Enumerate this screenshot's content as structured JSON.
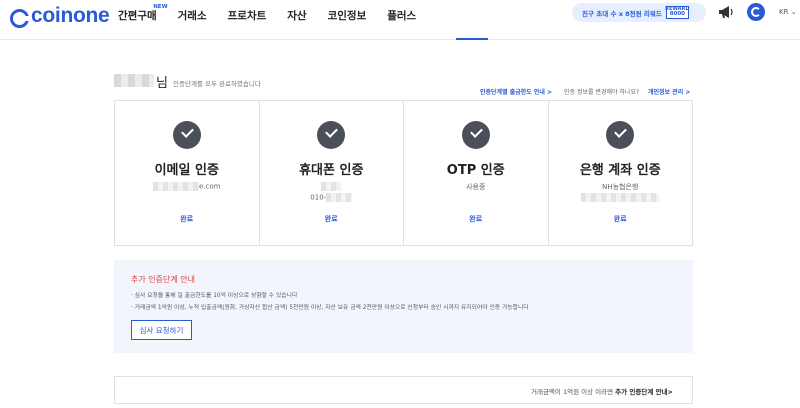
{
  "header": {
    "logo_text": "coinone",
    "nav": [
      {
        "label": "간편구매",
        "badge": "NEW"
      },
      {
        "label": "거래소"
      },
      {
        "label": "프로차트"
      },
      {
        "label": "자산"
      },
      {
        "label": "코인정보"
      },
      {
        "label": "플러스"
      }
    ],
    "promo_text": "친구 초대 수 x 8천원 리워드",
    "promo_badge_top": "REWARD",
    "promo_badge_bottom": "8000",
    "language": "KR"
  },
  "title_row": {
    "name_suffix": "님",
    "description": "인증단계를 모두 완료하였습니다",
    "limit_link": "인증단계별 출금한도 안내",
    "change_question": "인증 정보를 변경해야 하나요?",
    "manage_link": "개인정보 관리"
  },
  "cards": [
    {
      "title": "이메일 인증",
      "sub": "e.com",
      "sub2": "",
      "status": "완료"
    },
    {
      "title": "휴대폰 인증",
      "sub": "",
      "sub2": "010-",
      "status": "완료"
    },
    {
      "title": "OTP 인증",
      "sub": "사용중",
      "sub2": "",
      "status": "완료"
    },
    {
      "title": "은행 계좌 인증",
      "sub": "NH농협은행",
      "sub2": "",
      "status": "완료"
    }
  ],
  "notice": {
    "title": "추가 인증단계 안내",
    "line1": "· 심사 요청을 통해 일 출금한도를 10억 이상으로 상향할 수 있습니다",
    "line2": "· 거래금액 1억원 이상, 누적 입출금액(원화, 가상자산 합산 금액) 5천만원 이상, 자산 보유 금액 2천만원 이상으로 신청부터 승인 시까지 유지되어야 인증 가능합니다",
    "button_label": "심사 요청하기"
  },
  "bottom": {
    "text": "거래금액이 1억원 이상 이라면",
    "link": "추가 인증단계 안내",
    "chevron": ">"
  },
  "colors": {
    "brand": "#2a5bd7",
    "check": "#4a4f5a",
    "notice_bg": "#f2f6fc",
    "notice_title": "#e0413a"
  }
}
